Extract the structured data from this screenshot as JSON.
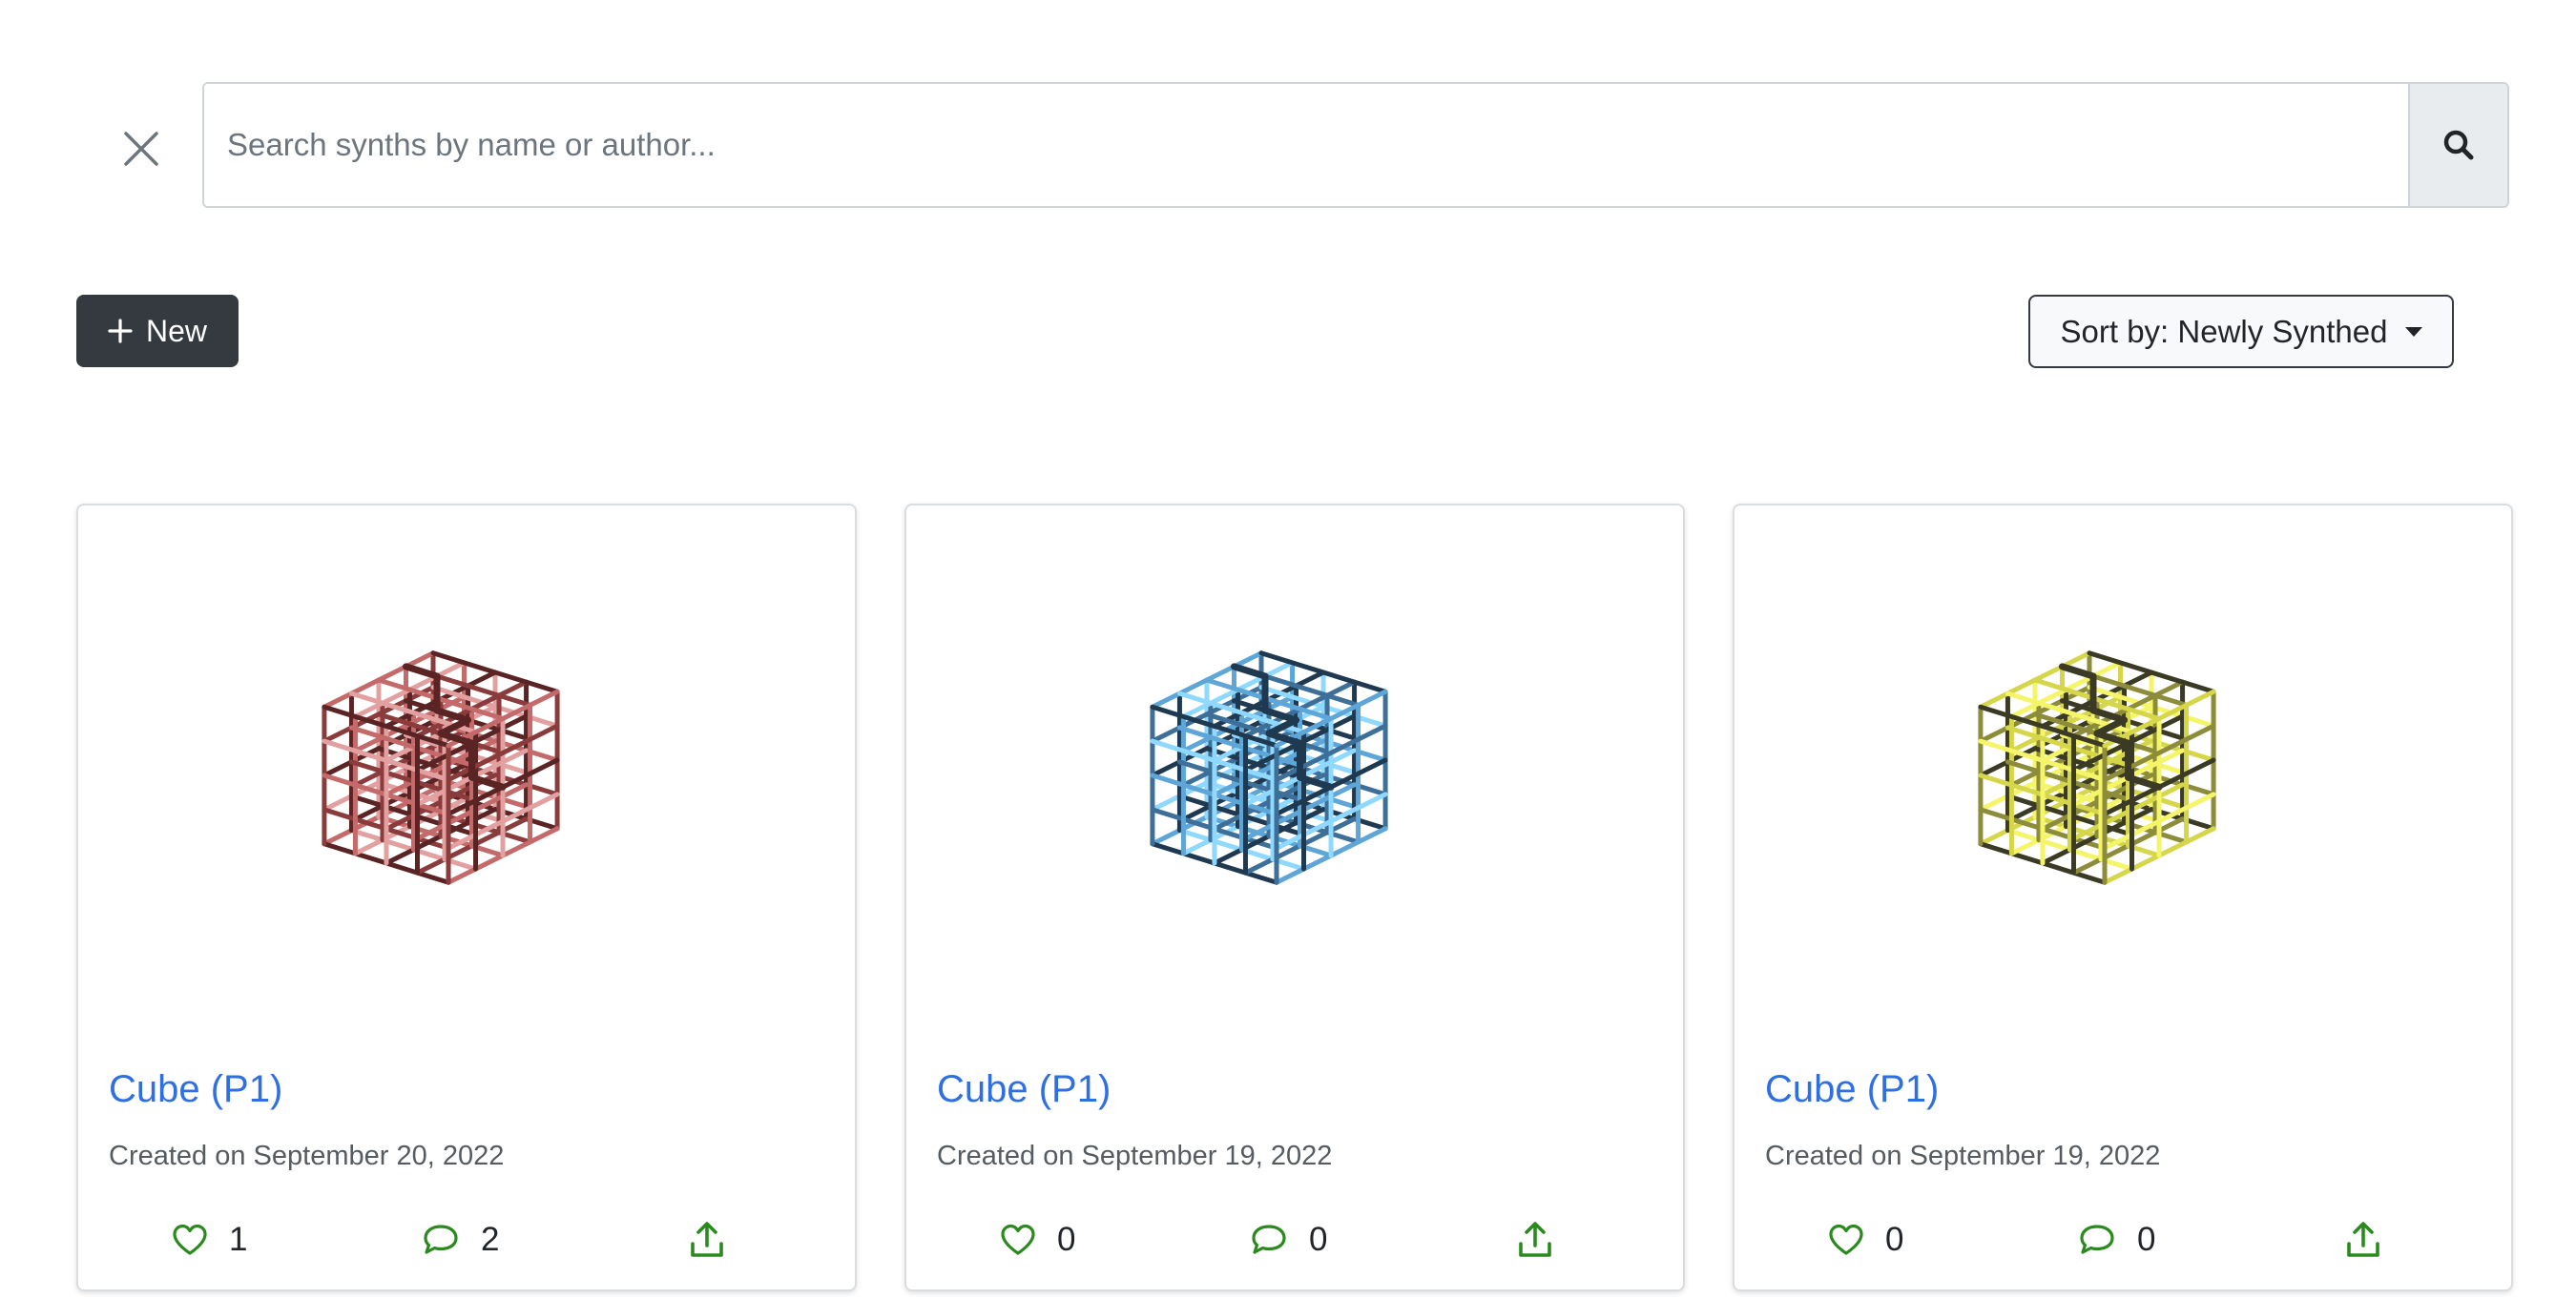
{
  "search": {
    "placeholder": "Search synths by name or author..."
  },
  "toolbar": {
    "new_label": "New",
    "sort_label": "Sort by: Newly Synthed"
  },
  "colors": {
    "accent_link": "#2f6fe4",
    "action_green": "#2a8a1e",
    "dark_button": "#343a40"
  },
  "cards": [
    {
      "title": "Cube (P1)",
      "date": "Created on September 20, 2022",
      "likes": "1",
      "comments": "2",
      "palette": [
        "#5a2424",
        "#8a3b3b",
        "#c46a6a",
        "#e3a0a0"
      ]
    },
    {
      "title": "Cube (P1)",
      "date": "Created on September 19, 2022",
      "likes": "0",
      "comments": "0",
      "palette": [
        "#1f3a50",
        "#3d6f99",
        "#5fa6d8",
        "#8fd8ff"
      ]
    },
    {
      "title": "Cube (P1)",
      "date": "Created on September 19, 2022",
      "likes": "0",
      "comments": "0",
      "palette": [
        "#3b3b25",
        "#8c8c3a",
        "#d6d64a",
        "#f5f56a"
      ]
    }
  ]
}
